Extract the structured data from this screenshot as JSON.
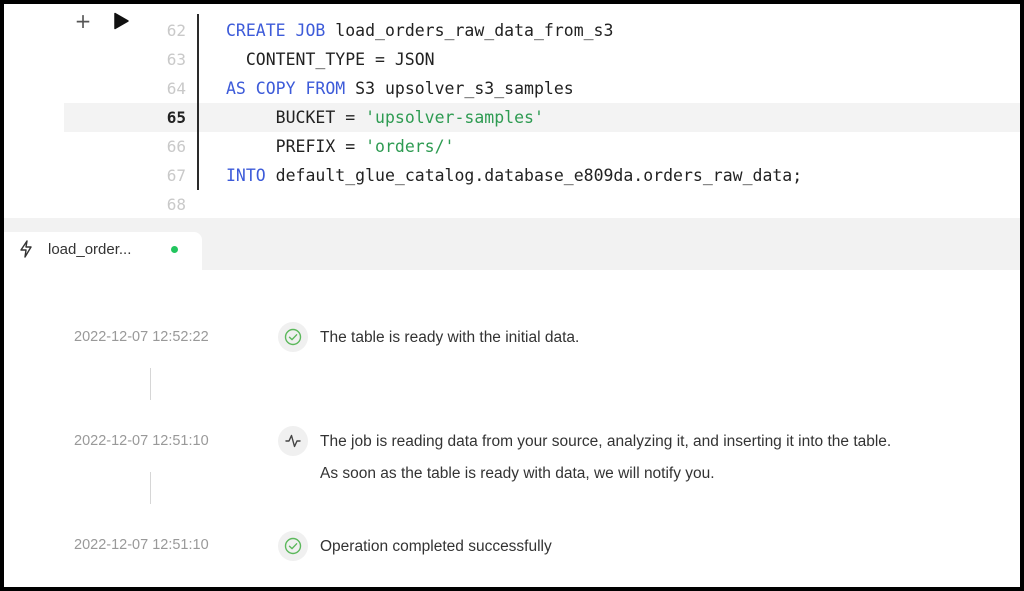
{
  "editor": {
    "lines": [
      {
        "num": "62",
        "segments": [
          {
            "t": "CREATE JOB",
            "c": "kw"
          },
          {
            "t": " load_orders_raw_data_from_s3",
            "c": ""
          }
        ]
      },
      {
        "num": "63",
        "segments": [
          {
            "t": "  CONTENT_TYPE = JSON",
            "c": ""
          }
        ]
      },
      {
        "num": "64",
        "segments": [
          {
            "t": "AS COPY FROM",
            "c": "kw"
          },
          {
            "t": " S3 upsolver_s3_samples",
            "c": ""
          }
        ]
      },
      {
        "num": "65",
        "segments": [
          {
            "t": "     BUCKET = ",
            "c": ""
          },
          {
            "t": "'upsolver-samples'",
            "c": "str"
          }
        ]
      },
      {
        "num": "66",
        "segments": [
          {
            "t": "     PREFIX = ",
            "c": ""
          },
          {
            "t": "'orders/'",
            "c": "str"
          }
        ]
      },
      {
        "num": "67",
        "segments": [
          {
            "t": "INTO",
            "c": "kw"
          },
          {
            "t": " default_glue_catalog.database_e809da.orders_raw_data;",
            "c": ""
          }
        ]
      },
      {
        "num": "68",
        "segments": []
      }
    ],
    "active_line": "65",
    "icons": {
      "add": "plus-icon",
      "run": "play-icon"
    }
  },
  "tab": {
    "label": "load_order...",
    "icon": "lightning-icon",
    "status_color": "#22c55e"
  },
  "log": {
    "events": [
      {
        "timestamp": "2022-12-07 12:52:22",
        "icon": "check-circle-icon",
        "lines": [
          "The table is ready with the initial data."
        ]
      },
      {
        "timestamp": "2022-12-07 12:51:10",
        "icon": "activity-icon",
        "lines": [
          "The job is reading data from your source, analyzing it, and inserting it into the table.",
          "As soon as the table is ready with data, we will notify you."
        ]
      },
      {
        "timestamp": "2022-12-07 12:51:10",
        "icon": "check-circle-icon",
        "lines": [
          "Operation completed successfully"
        ]
      }
    ]
  },
  "colors": {
    "keyword": "#3d5bd9",
    "string": "#2e9b52",
    "success": "#5cb85c"
  }
}
